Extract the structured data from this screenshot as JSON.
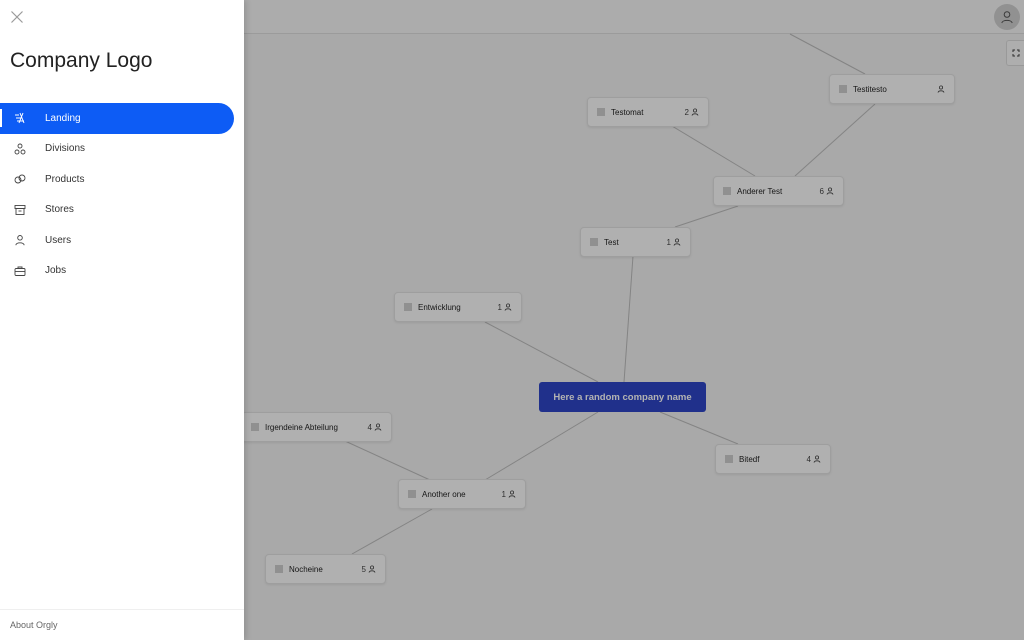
{
  "drawer": {
    "logo_text": "Company Logo",
    "nav": [
      {
        "label": "Landing",
        "icon": "landing-icon",
        "active": true
      },
      {
        "label": "Divisions",
        "icon": "divisions-icon",
        "active": false
      },
      {
        "label": "Products",
        "icon": "products-icon",
        "active": false
      },
      {
        "label": "Stores",
        "icon": "stores-icon",
        "active": false
      },
      {
        "label": "Users",
        "icon": "users-icon",
        "active": false
      },
      {
        "label": "Jobs",
        "icon": "jobs-icon",
        "active": false
      }
    ],
    "footer_label": "About Orgly"
  },
  "graph": {
    "root_label": "Here a random company name",
    "nodes": [
      {
        "label": "Testitesto",
        "count": ""
      },
      {
        "label": "Testomat",
        "count": "2"
      },
      {
        "label": "Anderer Test",
        "count": "6"
      },
      {
        "label": "Test",
        "count": "1"
      },
      {
        "label": "Entwicklung",
        "count": "1"
      },
      {
        "label": "Irgendeine Abteilung",
        "count": "4"
      },
      {
        "label": "Bitedf",
        "count": "4"
      },
      {
        "label": "Another one",
        "count": "1"
      },
      {
        "label": "Nocheine",
        "count": "5"
      }
    ]
  },
  "colors": {
    "accent": "#0d5cf5",
    "root_node": "#2e46c8",
    "overlay": "rgba(0,0,0,0.30)"
  }
}
